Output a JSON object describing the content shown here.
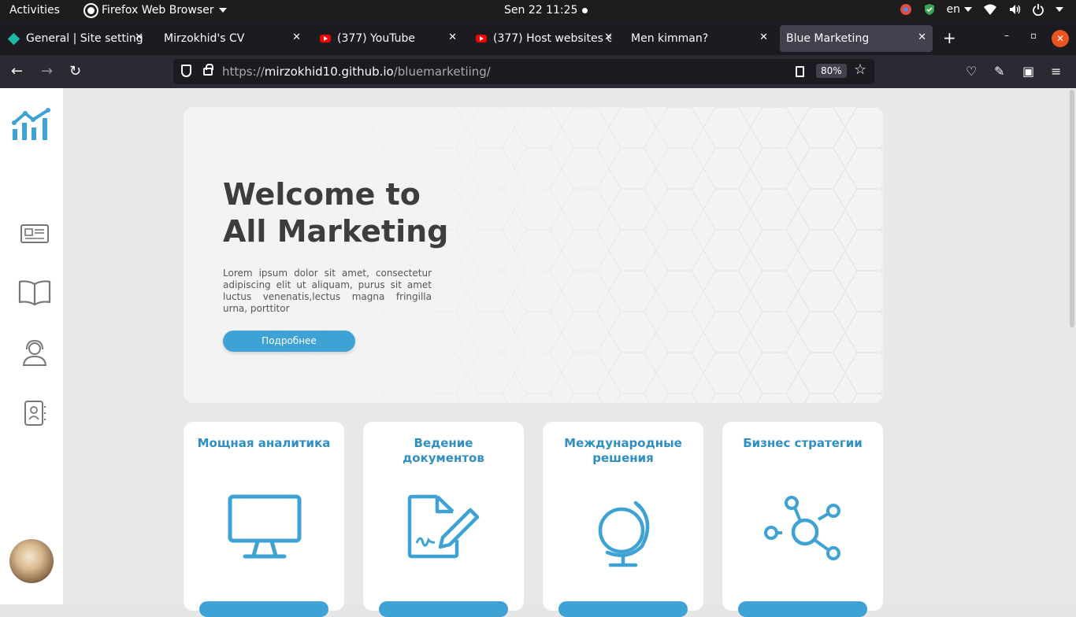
{
  "os_bar": {
    "activities": "Activities",
    "app_name": "Firefox Web Browser",
    "clock": "Sen 22  11:25",
    "lang": "en"
  },
  "tabs": [
    {
      "label": "General | Site settings",
      "favicon": "netlify-icon",
      "active": false
    },
    {
      "label": "Mirzokhid's CV",
      "favicon": "",
      "active": false
    },
    {
      "label": "(377) YouTube",
      "favicon": "youtube-icon",
      "active": false
    },
    {
      "label": "(377) Host websites c",
      "favicon": "youtube-icon",
      "active": false
    },
    {
      "label": "Men kimman?",
      "favicon": "",
      "active": false
    },
    {
      "label": "Blue Marketing",
      "favicon": "",
      "active": true
    }
  ],
  "navbar": {
    "url_prefix": "https://",
    "url_host": "mirzokhid10.github.io",
    "url_path": "/bluemarketiing/",
    "zoom": "80%"
  },
  "hero": {
    "title_line1": "Welcome to",
    "title_line2": "All Marketing",
    "description": "Lorem ipsum dolor sit amet, consectetur adipiscing elit ut aliquam, purus sit amet luctus venenatis,lectus magna fringilla urna, porttitor",
    "button_label": "Подробнее"
  },
  "cards": [
    {
      "title": "Мощная аналитика",
      "icon": "monitor-icon"
    },
    {
      "title": "Ведение документов",
      "icon": "document-sign-icon"
    },
    {
      "title": "Международные решения",
      "icon": "globe-icon"
    },
    {
      "title": "Бизнес стратегии",
      "icon": "network-icon"
    }
  ],
  "colors": {
    "accent": "#3fa2d5",
    "card_title": "#2f8fc3",
    "heading": "#3d3d3d"
  }
}
